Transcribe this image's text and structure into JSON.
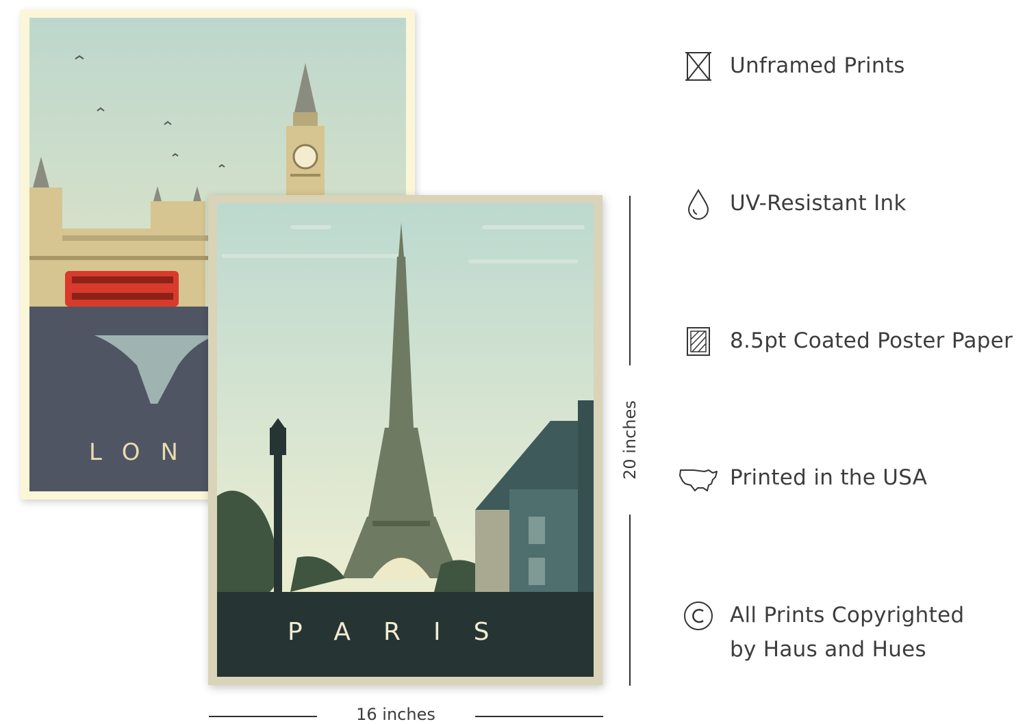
{
  "posters": {
    "london": {
      "title": "LON"
    },
    "paris": {
      "title": "PARIS"
    }
  },
  "dimensions": {
    "width_label": "16 inches",
    "height_label": "20 inches"
  },
  "features": [
    {
      "icon": "unframed-box-icon",
      "text": "Unframed Prints"
    },
    {
      "icon": "ink-drop-icon",
      "text": "UV-Resistant Ink"
    },
    {
      "icon": "coated-paper-icon",
      "text": "8.5pt Coated Poster Paper"
    },
    {
      "icon": "usa-map-icon",
      "text": "Printed in the USA"
    },
    {
      "icon": "copyright-icon",
      "text": "All Prints Copyrighted",
      "text2": "by Haus and Hues"
    }
  ],
  "colors": {
    "london_frame": "#fbf6d8",
    "paris_frame": "#d9d3b8",
    "sky_top": "#bcd9cf",
    "bus_red": "#d83a2c",
    "paris_ground": "#263434",
    "tower": "#6e7a62"
  }
}
